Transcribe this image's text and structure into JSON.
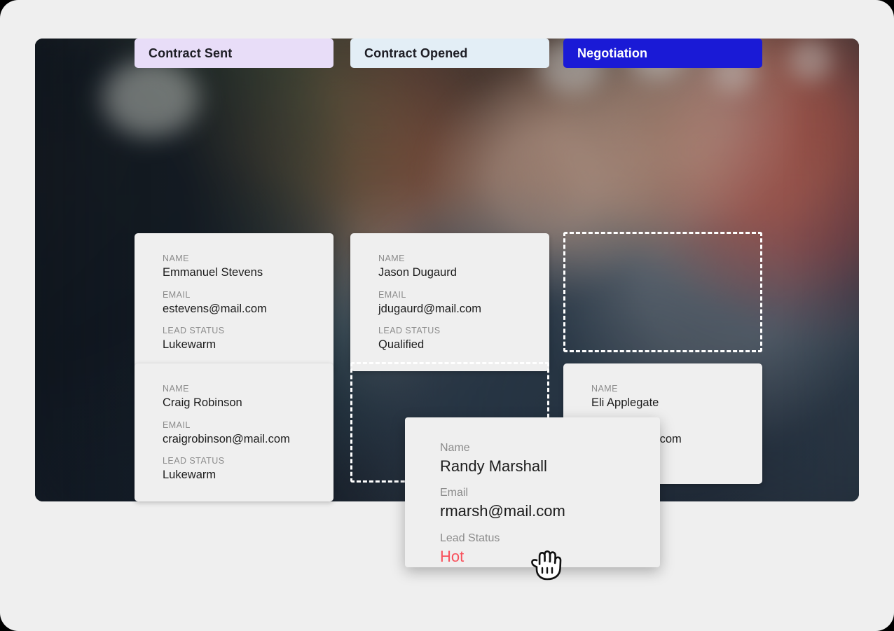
{
  "board": {
    "columns": [
      {
        "id": "contract-sent",
        "title": "Contract Sent",
        "header_bg": "#e8ddf8",
        "header_fg": "#1d1d24"
      },
      {
        "id": "contract-opened",
        "title": "Contract Opened",
        "header_bg": "#e3eef6",
        "header_fg": "#1d1d24"
      },
      {
        "id": "negotiation",
        "title": "Negotiation",
        "header_bg": "#1a1ad6",
        "header_fg": "#ffffff"
      }
    ],
    "field_labels": {
      "name": "NAME",
      "email": "EMAIL",
      "lead_status": "LEAD STATUS"
    },
    "cards": [
      {
        "column": "contract-sent",
        "row": 1,
        "name": "Emmanuel Stevens",
        "email": "estevens@mail.com",
        "lead_status": "Lukewarm"
      },
      {
        "column": "contract-opened",
        "row": 1,
        "name": "Jason Dugaurd",
        "email": "jdugaurd@mail.com",
        "lead_status": "Qualified"
      },
      {
        "column": "contract-sent",
        "row": 2,
        "name": "Craig Robinson",
        "email": "craigrobinson@mail.com",
        "lead_status": "Lukewarm"
      },
      {
        "column": "negotiation",
        "row": 2,
        "name": "Eli Applegate",
        "email": "@mail.com",
        "lead_status": ""
      }
    ],
    "placeholders": [
      {
        "column": "negotiation",
        "row": 1
      },
      {
        "column": "contract-opened",
        "row": 2
      }
    ]
  },
  "drag_card": {
    "labels": {
      "name": "Name",
      "email": "Email",
      "lead_status": "Lead Status"
    },
    "name": "Randy Marshall",
    "email": "rmarsh@mail.com",
    "lead_status": "Hot",
    "lead_status_color": "#f8515c"
  },
  "cursor": {
    "type": "grabbing-hand"
  }
}
